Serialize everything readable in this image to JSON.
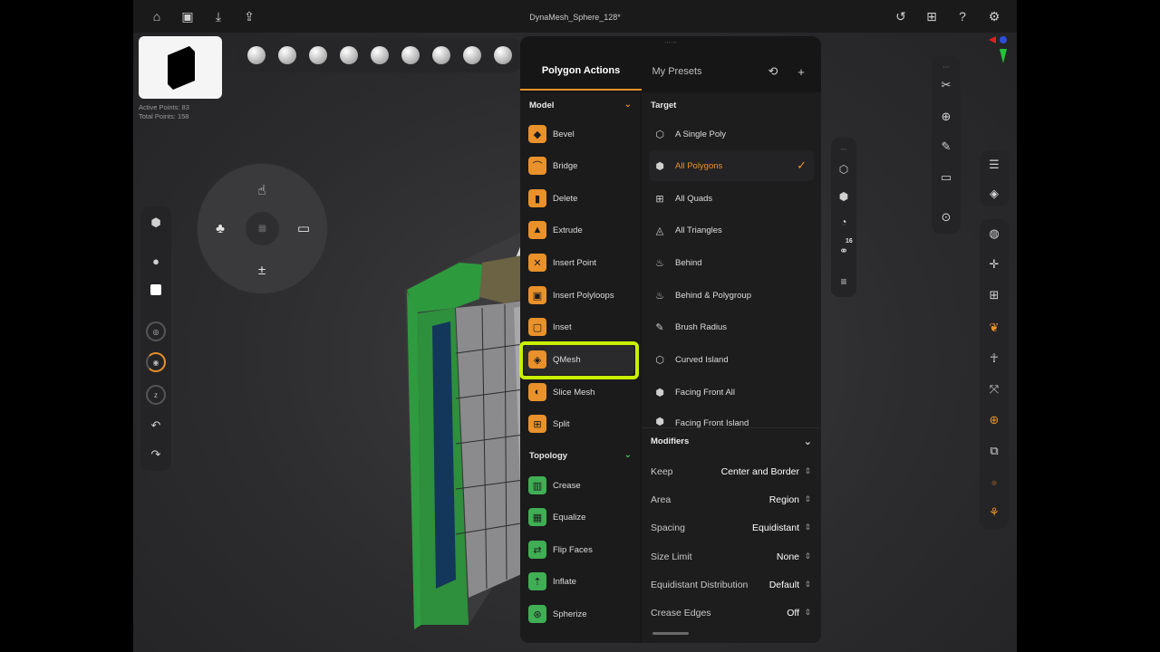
{
  "document": {
    "title": "DynaMesh_Sphere_128*"
  },
  "stats": {
    "active_points": "Active Points: 83",
    "total_points": "Total Points: 158"
  },
  "panel": {
    "tab_active": "Polygon Actions",
    "tab_other": "My Presets",
    "model_section": "Model",
    "model_actions": [
      "Bevel",
      "Bridge",
      "Delete",
      "Extrude",
      "Insert Point",
      "Insert Polyloops",
      "Inset",
      "QMesh",
      "Slice Mesh",
      "Split"
    ],
    "topology_section": "Topology",
    "topology_actions": [
      "Crease",
      "Equalize",
      "Flip Faces",
      "Inflate",
      "Spherize"
    ],
    "target_section": "Target",
    "targets": [
      "A Single Poly",
      "All Polygons",
      "All Quads",
      "All Triangles",
      "Behind",
      "Behind & Polygroup",
      "Brush Radius",
      "Curved Island",
      "Facing Front All",
      "Facing Front Island"
    ],
    "selected_target": "All Polygons",
    "selected_action": "QMesh",
    "modifiers_section": "Modifiers",
    "modifiers": [
      {
        "key": "Keep",
        "value": "Center and Border"
      },
      {
        "key": "Area",
        "value": "Region"
      },
      {
        "key": "Spacing",
        "value": "Equidistant"
      },
      {
        "key": "Size Limit",
        "value": "None"
      },
      {
        "key": "Equidistant Distribution",
        "value": "Default"
      },
      {
        "key": "Crease Edges",
        "value": "Off"
      }
    ]
  },
  "midstrip": {
    "count_badge": "16"
  },
  "colors": {
    "accent": "#e9912a",
    "topology": "#3fae54",
    "highlight": "#c8f000",
    "panel_bg": "#161617"
  }
}
